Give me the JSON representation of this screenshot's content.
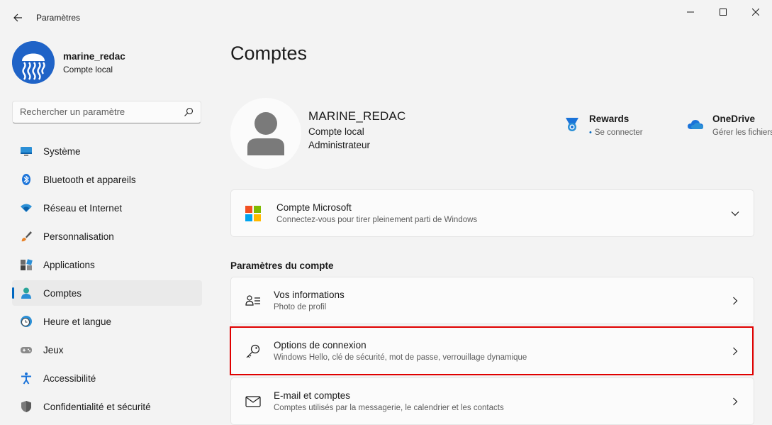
{
  "window": {
    "title": "Paramètres"
  },
  "profile": {
    "username": "marine_redac",
    "account_type": "Compte local"
  },
  "search": {
    "placeholder": "Rechercher un paramètre",
    "value": ""
  },
  "sidebar": {
    "items": [
      {
        "label": "Système",
        "icon": "monitor-icon",
        "active": false
      },
      {
        "label": "Bluetooth et appareils",
        "icon": "bluetooth-icon",
        "active": false
      },
      {
        "label": "Réseau et Internet",
        "icon": "wifi-icon",
        "active": false
      },
      {
        "label": "Personnalisation",
        "icon": "paintbrush-icon",
        "active": false
      },
      {
        "label": "Applications",
        "icon": "apps-icon",
        "active": false
      },
      {
        "label": "Comptes",
        "icon": "person-icon",
        "active": true
      },
      {
        "label": "Heure et langue",
        "icon": "clock-globe-icon",
        "active": false
      },
      {
        "label": "Jeux",
        "icon": "gamepad-icon",
        "active": false
      },
      {
        "label": "Accessibilité",
        "icon": "accessibility-icon",
        "active": false
      },
      {
        "label": "Confidentialité et sécurité",
        "icon": "shield-icon",
        "active": false
      }
    ]
  },
  "main": {
    "title": "Comptes",
    "account": {
      "name": "MARINE_REDAC",
      "type": "Compte local",
      "role": "Administrateur"
    },
    "services": {
      "rewards": {
        "name": "Rewards",
        "status": "Se connecter"
      },
      "onedrive": {
        "name": "OneDrive",
        "status": "Gérer les fichiers"
      }
    },
    "microsoft_account": {
      "title": "Compte Microsoft",
      "subtitle": "Connectez-vous pour tirer pleinement parti de Windows"
    },
    "section_heading": "Paramètres du compte",
    "settings": [
      {
        "title": "Vos informations",
        "subtitle": "Photo de profil",
        "icon": "person-details-icon"
      },
      {
        "title": "Options de connexion",
        "subtitle": "Windows Hello, clé de sécurité, mot de passe, verrouillage dynamique",
        "icon": "key-icon"
      },
      {
        "title": "E-mail et comptes",
        "subtitle": "Comptes utilisés par la messagerie, le calendrier et les contacts",
        "icon": "mail-icon"
      }
    ]
  },
  "colors": {
    "accent": "#0067c0",
    "highlight": "#e00000",
    "background": "#f3f3f3",
    "card": "#fbfbfb"
  }
}
